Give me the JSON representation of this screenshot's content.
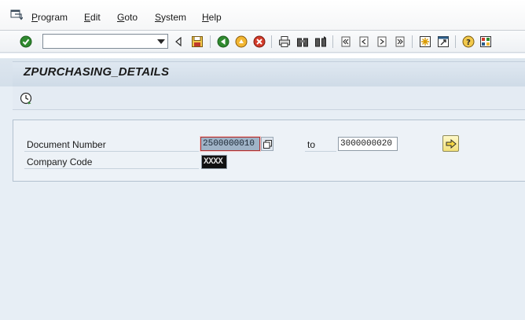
{
  "menu": {
    "items": [
      {
        "prefix": "",
        "underlined": "P",
        "rest": "rogram"
      },
      {
        "prefix": "",
        "underlined": "E",
        "rest": "dit"
      },
      {
        "prefix": "",
        "underlined": "G",
        "rest": "oto"
      },
      {
        "prefix": "",
        "underlined": "S",
        "rest": "ystem"
      },
      {
        "prefix": "",
        "underlined": "H",
        "rest": "elp"
      }
    ]
  },
  "toolbar": {
    "command_value": "",
    "icons": [
      "enter-check-icon",
      "back-arrow-icon",
      "save-icon",
      "back-green-icon",
      "exit-yellow-icon",
      "cancel-red-icon",
      "print-icon",
      "find-icon",
      "find-next-icon",
      "first-page-icon",
      "previous-page-icon",
      "next-page-icon",
      "last-page-icon",
      "create-session-icon",
      "shortcut-icon",
      "help-icon",
      "layout-menu-icon"
    ]
  },
  "title": {
    "text": "ZPURCHASING_DETAILS"
  },
  "selection": {
    "document_number": {
      "label": "Document Number",
      "from": "2500000010",
      "to_label": "to",
      "to": "3000000020"
    },
    "company_code": {
      "label": "Company Code",
      "value": "XXXX"
    }
  },
  "colors": {
    "background": "#e7eef5",
    "title_strip": "#d4dfea",
    "focus_border": "#b03030",
    "selected_field": "#9fb3c7",
    "multi_select_button": "#f2e07a"
  }
}
